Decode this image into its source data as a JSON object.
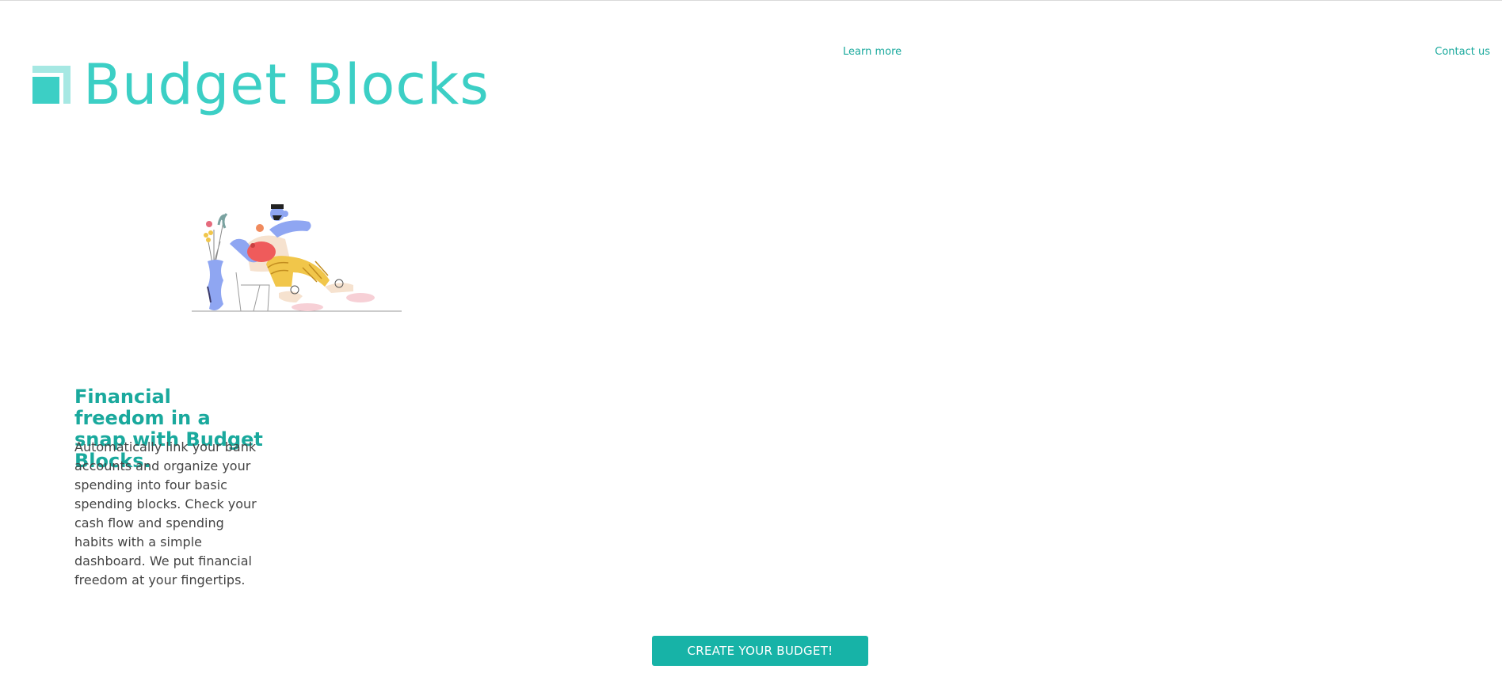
{
  "brand": {
    "title": "Budget Blocks",
    "primary_color": "#3ccfc5",
    "accent_color": "#1aa99d",
    "logo_icon": "blocks-logo-icon"
  },
  "nav": {
    "learn_more": "Learn more",
    "contact_us": "Contact us"
  },
  "hero": {
    "illustration": "person-with-piggy-bank-illustration",
    "headline": "Financial freedom in a snap with Budget Blocks.",
    "description": "Automatically link your bank accounts and organize your spending into four basic spending blocks. Check your cash flow and spending habits with a simple dashboard. We put financial freedom at your fingertips."
  },
  "cta": {
    "label": "CREATE YOUR BUDGET!",
    "color": "#17b3a7"
  }
}
